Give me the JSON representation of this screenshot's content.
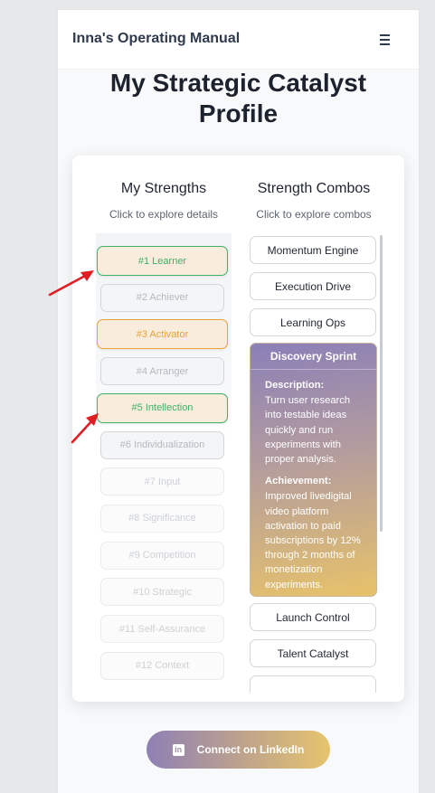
{
  "header": {
    "brand": "Inna's Operating Manual",
    "menu_icon": "hamburger-icon"
  },
  "page_title": "My Strategic Catalyst Profile",
  "strengths": {
    "title": "My Strengths",
    "subtitle": "Click to explore details",
    "items": [
      {
        "label": "#1 Learner",
        "state": "highlight-green"
      },
      {
        "label": "#2 Achiever",
        "state": "dim"
      },
      {
        "label": "#3 Activator",
        "state": "highlight-orange"
      },
      {
        "label": "#4 Arranger",
        "state": "dim"
      },
      {
        "label": "#5 Intellection",
        "state": "highlight-green"
      },
      {
        "label": "#6 Individualization",
        "state": "dim"
      },
      {
        "label": "#7 Input",
        "state": "faded"
      },
      {
        "label": "#8 Significance",
        "state": "faded"
      },
      {
        "label": "#9 Competition",
        "state": "faded"
      },
      {
        "label": "#10 Strategic",
        "state": "faded"
      },
      {
        "label": "#11 Self-Assurance",
        "state": "faded"
      },
      {
        "label": "#12 Context",
        "state": "faded"
      }
    ]
  },
  "combos": {
    "title": "Strength Combos",
    "subtitle": "Click to explore combos",
    "items": [
      {
        "label": "Momentum Engine"
      },
      {
        "label": "Execution Drive"
      },
      {
        "label": "Learning Ops"
      },
      {
        "label": "Discovery Sprint",
        "expanded": true
      },
      {
        "label": "Launch Control"
      },
      {
        "label": "Talent Catalyst"
      }
    ],
    "expanded": {
      "title": "Discovery Sprint",
      "description_label": "Description:",
      "description": "Turn user research into testable ideas quickly and run experiments with proper analysis.",
      "achievement_label": "Achievement:",
      "achievement": "Improved livedigital video platform activation to paid subscriptions by 12% through 2 months of monetization experiments."
    }
  },
  "linkedin": {
    "label": "Connect on LinkedIn",
    "icon": "linkedin-icon",
    "icon_text": "in"
  },
  "colors": {
    "green": "#3fb068",
    "orange": "#e8a33a",
    "highlight_bg": "#f8ecdc",
    "gradient_start": "#8b7fb8",
    "gradient_end": "#e7c26a",
    "arrow": "#e11d24"
  }
}
